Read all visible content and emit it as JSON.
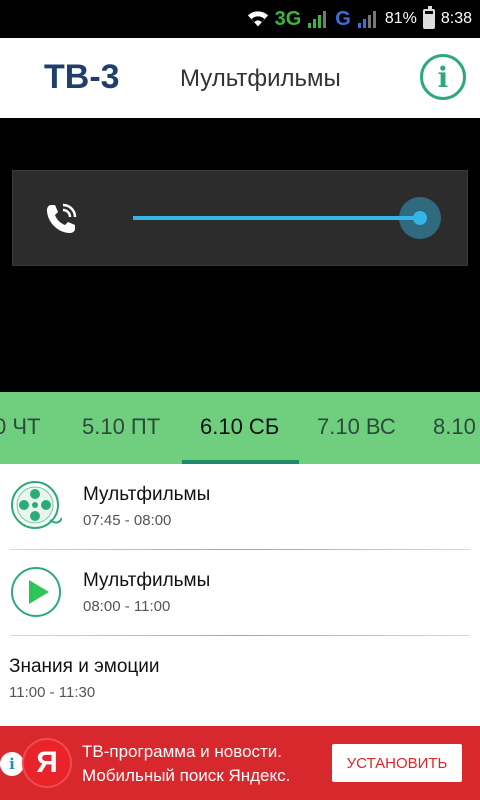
{
  "status_bar": {
    "network_3g": "3G",
    "network_g": "G",
    "battery_percent": "81%",
    "battery_level": 0.81,
    "time": "8:38",
    "icons": [
      "wifi-icon",
      "signal-icon",
      "battery-icon"
    ]
  },
  "header": {
    "logo": "ТВ-3",
    "title": "Мультфильмы",
    "info_icon": "i",
    "accent_color": "#2eaa7a"
  },
  "player": {
    "volume_icon": "phone-in-call-icon",
    "volume_level": 1.0,
    "slider_color": "#33b5e5"
  },
  "date_tabs": {
    "items": [
      "0 ЧТ",
      "5.10 ПТ",
      "6.10 СБ",
      "7.10 ВС",
      "8.10"
    ],
    "selected_index": 2,
    "background_color": "#6fcf7f"
  },
  "schedule": [
    {
      "name": "Мультфильмы",
      "time": "07:45 - 08:00",
      "icon": "film-reel-icon"
    },
    {
      "name": "Мультфильмы",
      "time": "08:00 - 11:00",
      "icon": "play-icon"
    },
    {
      "name": "Знания и эмоции",
      "time": "11:00 - 11:30",
      "icon": ""
    }
  ],
  "ad": {
    "info_icon": "i",
    "logo": "Я",
    "line1": "ТВ-программа и новости.",
    "line2": "Мобильный поиск Яндекс.",
    "button": "УСТАНОВИТЬ",
    "background_color": "#d7282e"
  }
}
